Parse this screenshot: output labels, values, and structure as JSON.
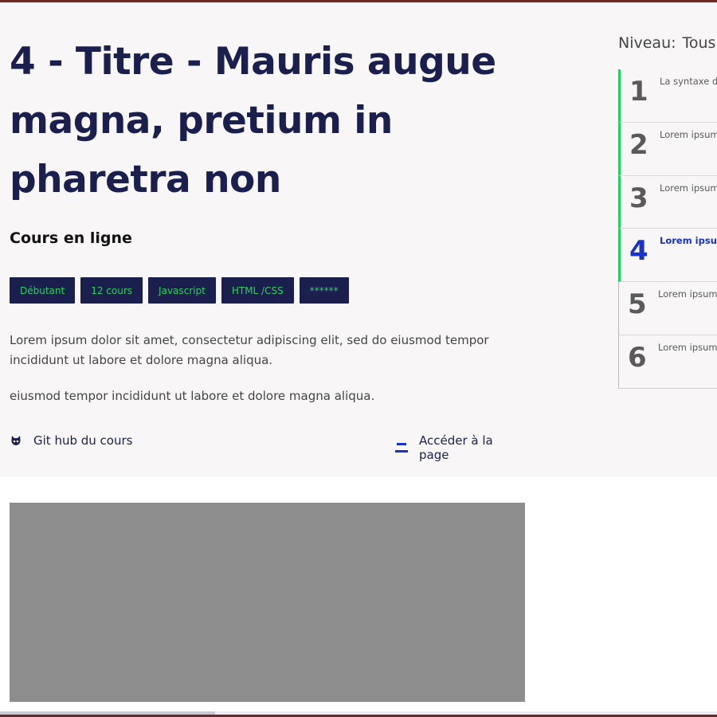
{
  "course": {
    "title": "4 - Titre - Mauris augue magna, pretium in pharetra non",
    "subtitle": "Cours en ligne",
    "tags": [
      "Débutant",
      "12 cours",
      "Javascript",
      "HTML /CSS",
      "******"
    ],
    "description": [
      "Lorem ipsum dolor sit amet, consectetur adipiscing elit, sed do eiusmod tempor incididunt ut labore et dolore magna aliqua.",
      "eiusmod tempor incididunt ut labore et dolore magna aliqua."
    ],
    "links": {
      "github_label": "Git hub du cours",
      "access_label": "Accéder à la page"
    }
  },
  "sidebar": {
    "level_label": "Niveau:",
    "level_value": "Tous",
    "lessons": [
      {
        "num": "1",
        "title": "La syntaxe d",
        "state": "done"
      },
      {
        "num": "2",
        "title": "Lorem ipsum",
        "state": "done"
      },
      {
        "num": "3",
        "title": "Lorem ipsum",
        "state": "done"
      },
      {
        "num": "4",
        "title": "Lorem ipsum",
        "state": "active"
      },
      {
        "num": "5",
        "title": "Lorem ipsum",
        "state": "todo"
      },
      {
        "num": "6",
        "title": "Lorem ipsum",
        "state": "todo"
      }
    ]
  },
  "icons": {
    "github": "github-icon",
    "access": "menu-bars-icon"
  },
  "colors": {
    "navy": "#1a1f4e",
    "green": "#21d25c",
    "active_blue": "#1932c8",
    "border": "#6b2a2a",
    "hero_bg": "#f8f6f6",
    "video_bg": "#8e8d8d"
  }
}
